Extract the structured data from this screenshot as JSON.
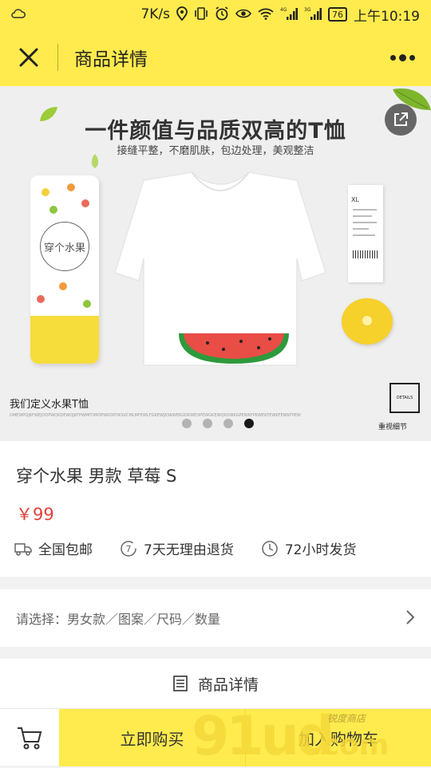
{
  "status_bar": {
    "speed": "7K/s",
    "signal_a": "4G",
    "signal_b": "3G",
    "battery": "76",
    "time": "上午10:19"
  },
  "nav": {
    "title": "商品详情",
    "close_icon": "close-icon",
    "more_icon": "more-icon"
  },
  "banner": {
    "headline": "一件颜值与品质双高的T恤",
    "subline": "接缝平整，不磨肌肤，包边处理，美观整洁",
    "caption": "我们定义水果T恤",
    "caption_small": "DMEWPOJKFWEJODPWQKDEWOJKFPWMFDMOPWKDPOKSVCMLMFEWLFGKEWJKSKWEKGDKWEDPEWGKEWQKDWKGPEWKFPKWEKFEWKFEWKFPEW",
    "details_box": "DETAILS",
    "details_caption": "重视细节",
    "tube_label": "穿个水果",
    "tag_size": "XL",
    "carousel_total": 4,
    "carousel_active": 4
  },
  "product": {
    "title": "穿个水果 男款 草莓 S",
    "price": "￥99",
    "services": [
      {
        "label": "全国包邮",
        "icon": "truck-icon"
      },
      {
        "label": "7天无理由退货",
        "icon": "seven-day-icon"
      },
      {
        "label": "72小时发货",
        "icon": "clock-icon"
      }
    ]
  },
  "selector": {
    "text": "请选择：男女款／图案／尺码／数量"
  },
  "details_header": {
    "label": "商品详情"
  },
  "bottom_bar": {
    "buy_now": "立即购买",
    "add_to_cart": "加入购物车"
  },
  "watermark": {
    "brand": "91ud",
    "suffix": ".com",
    "tagline": "锐度商店"
  },
  "colors": {
    "accent_yellow": "#ffeb4d",
    "price_red": "#e0413a"
  }
}
